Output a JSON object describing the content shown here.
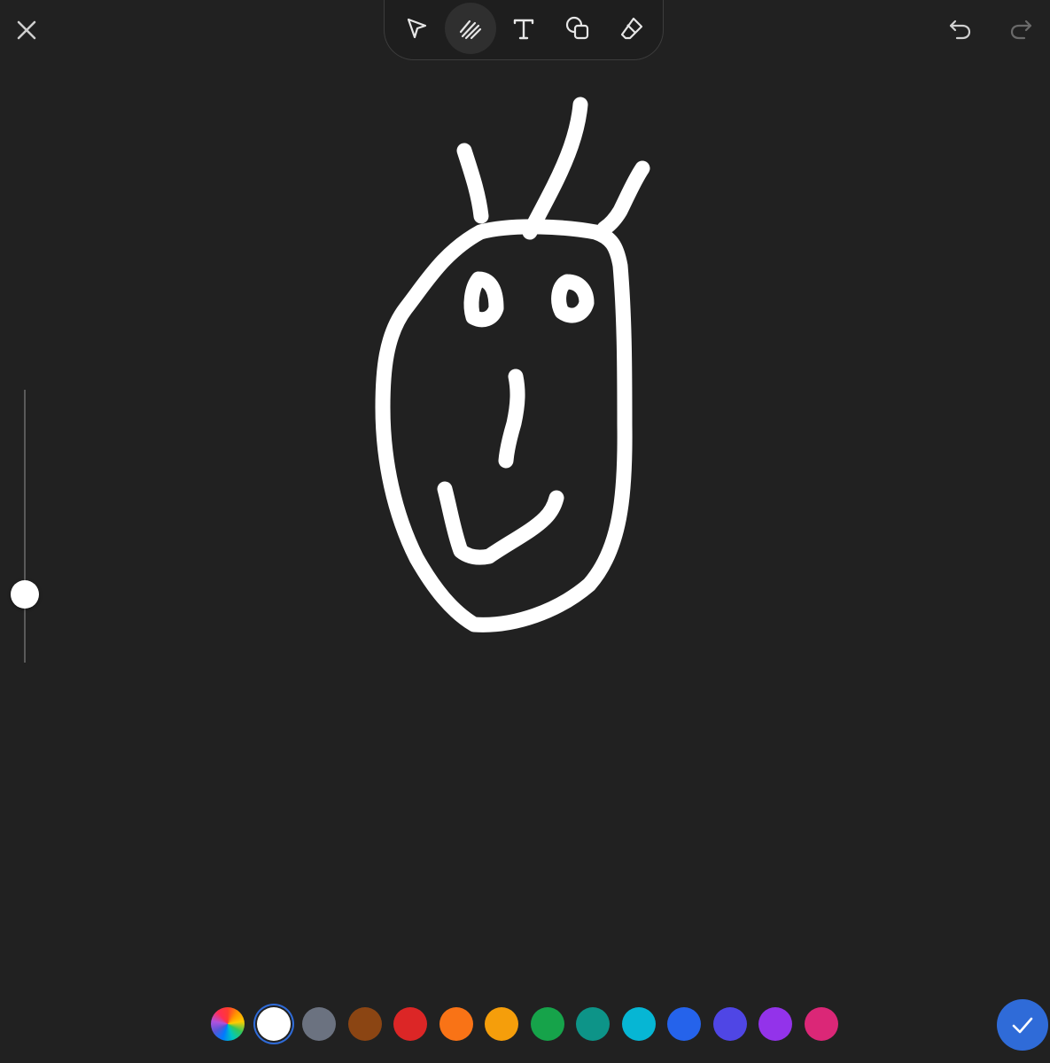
{
  "header": {
    "close_icon": "close-icon",
    "undo_icon": "undo-icon",
    "redo_icon": "redo-icon"
  },
  "toolbar": {
    "tools": [
      {
        "name": "select",
        "icon": "pointer-icon",
        "active": false
      },
      {
        "name": "pen",
        "icon": "pen-scribble-icon",
        "active": true
      },
      {
        "name": "text",
        "icon": "text-icon",
        "active": false
      },
      {
        "name": "shapes",
        "icon": "shapes-icon",
        "active": false
      },
      {
        "name": "eraser",
        "icon": "eraser-icon",
        "active": false
      }
    ]
  },
  "stroke_size": {
    "level": 0.2
  },
  "palette": {
    "colors": [
      {
        "name": "color-picker",
        "value": "rainbow"
      },
      {
        "name": "white",
        "value": "#ffffff",
        "selected": true
      },
      {
        "name": "gray",
        "value": "#6b7280"
      },
      {
        "name": "brown",
        "value": "#8b4513"
      },
      {
        "name": "red",
        "value": "#dc2626"
      },
      {
        "name": "orange",
        "value": "#f97316"
      },
      {
        "name": "amber",
        "value": "#f59e0b"
      },
      {
        "name": "green",
        "value": "#16a34a"
      },
      {
        "name": "teal",
        "value": "#0d9488"
      },
      {
        "name": "cyan",
        "value": "#06b6d4"
      },
      {
        "name": "blue",
        "value": "#2563eb"
      },
      {
        "name": "indigo",
        "value": "#4f46e5"
      },
      {
        "name": "purple",
        "value": "#9333ea"
      },
      {
        "name": "pink",
        "value": "#db2777"
      }
    ]
  },
  "done": {
    "icon": "checkmark-icon",
    "color": "#2f6bd8"
  },
  "canvas": {
    "background": "#212121",
    "stroke_color": "#ffffff",
    "drawing": "smiley-face-sketch"
  }
}
